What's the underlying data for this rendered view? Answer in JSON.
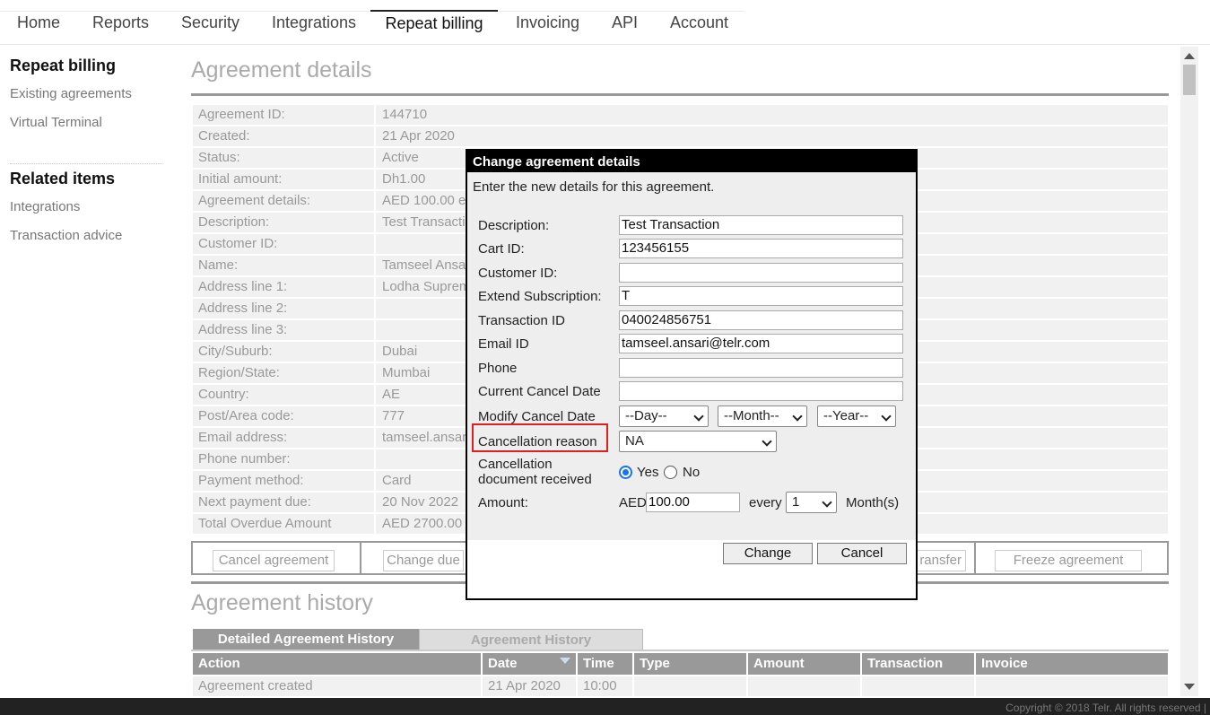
{
  "nav": {
    "tabs": [
      "Home",
      "Reports",
      "Security",
      "Integrations",
      "Repeat billing",
      "Invoicing",
      "API",
      "Account"
    ],
    "active": "Repeat billing"
  },
  "sidebar": {
    "heading1": "Repeat billing",
    "links1": [
      "Existing agreements",
      "Virtual Terminal"
    ],
    "heading2": "Related items",
    "links2": [
      "Integrations",
      "Transaction advice"
    ]
  },
  "agreement": {
    "title": "Agreement details",
    "rows": [
      {
        "label": "Agreement ID:",
        "value": "144710"
      },
      {
        "label": "Created:",
        "value": "21 Apr 2020"
      },
      {
        "label": "Status:",
        "value": "Active"
      },
      {
        "label": "Initial amount:",
        "value": "Dh1.00"
      },
      {
        "label": "Agreement details:",
        "value": "AED 100.00 e"
      },
      {
        "label": "Description:",
        "value": "Test Transacti"
      },
      {
        "label": "Customer ID:",
        "value": ""
      },
      {
        "label": "Name:",
        "value": "Tamseel Ansa"
      },
      {
        "label": "Address line 1:",
        "value": "Lodha Suprem"
      },
      {
        "label": "Address line 2:",
        "value": ""
      },
      {
        "label": "Address line 3:",
        "value": ""
      },
      {
        "label": "City/Suburb:",
        "value": "Dubai"
      },
      {
        "label": "Region/State:",
        "value": "Mumbai"
      },
      {
        "label": "Country:",
        "value": "AE"
      },
      {
        "label": "Post/Area code:",
        "value": "777"
      },
      {
        "label": "Email address:",
        "value": "tamseel.ansar"
      },
      {
        "label": "Phone number:",
        "value": ""
      },
      {
        "label": "Payment method:",
        "value": "Card"
      },
      {
        "label": "Next payment due:",
        "value": "20 Nov 2022"
      },
      {
        "label": "Total Overdue Amount",
        "value": "AED 2700.00"
      }
    ],
    "buttons": {
      "cancel": "Cancel agreement",
      "change_due": "Change due",
      "transfer": "ransfer",
      "freeze": "Freeze agreement"
    }
  },
  "history": {
    "title": "Agreement history",
    "tab_detailed": "Detailed Agreement History",
    "tab_history": "Agreement History",
    "columns": [
      "Action",
      "Date",
      "Time",
      "Type",
      "Amount",
      "Transaction",
      "Invoice"
    ],
    "row": [
      "Agreement created",
      "21 Apr 2020",
      "10:00",
      "",
      "",
      "",
      ""
    ]
  },
  "modal": {
    "title": "Change agreement details",
    "intro": "Enter the new details for this agreement.",
    "fields": {
      "description_label": "Description:",
      "description": "Test Transaction",
      "cart_label": "Cart ID:",
      "cart": "123456155",
      "customer_label": "Customer ID:",
      "customer": "",
      "extend_label": "Extend Subscription:",
      "extend": "T",
      "txn_label": "Transaction ID",
      "txn": "040024856751",
      "email_label": "Email ID",
      "email": "tamseel.ansari@telr.com",
      "phone_label": "Phone",
      "phone": "",
      "current_cancel_label": "Current Cancel Date",
      "current_cancel": "",
      "modify_cancel_label": "Modify Cancel Date",
      "day": "--Day--",
      "month": "--Month--",
      "year": "--Year--",
      "reason_label": "Cancellation reason",
      "reason": "NA",
      "doc_label_1": "Cancellation",
      "doc_label_2": "document received",
      "yes": "Yes",
      "no": "No",
      "amount_label": "Amount:",
      "currency": "AED",
      "amount": "100.00",
      "every": "every",
      "interval": "1",
      "unit": "Month(s)"
    },
    "change_button": "Change",
    "cancel_button": "Cancel"
  },
  "footer": "Copyright © 2018 Telr. All rights reserved |",
  "colors": {
    "highlight": "#e02020",
    "radio_checked": "#1a73e8"
  }
}
